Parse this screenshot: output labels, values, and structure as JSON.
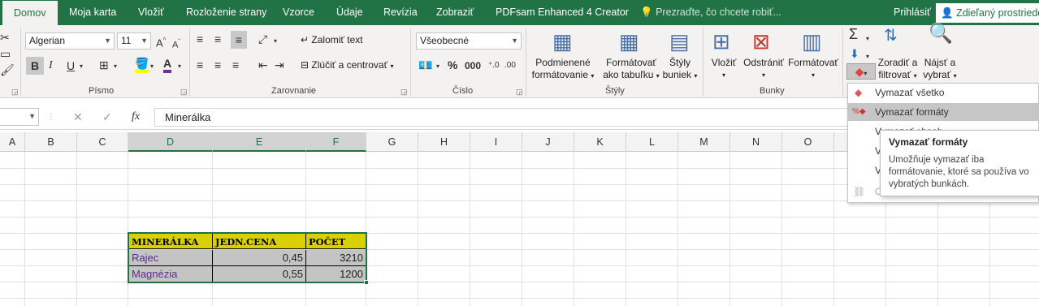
{
  "tabs": [
    "Domov",
    "Moja karta",
    "Vložiť",
    "Rozloženie strany",
    "Vzorce",
    "Údaje",
    "Revízia",
    "Zobraziť",
    "PDFsam Enhanced 4 Creator"
  ],
  "tell_me": "Prezraďte, čo chcete robiť...",
  "signin": "Prihlásiť",
  "share": "Zdieľaný prostriedok",
  "font": {
    "name": "Algerian",
    "size": "11",
    "group_label": "Písmo"
  },
  "alignment": {
    "wrap": "Zalomiť text",
    "merge": "Zlúčiť a centrovať",
    "group_label": "Zarovnanie"
  },
  "number": {
    "format": "Všeobecné",
    "group_label": "Číslo"
  },
  "styles": {
    "cond_line1": "Podmienené",
    "cond_line2": "formátovanie",
    "table_line1": "Formátovať",
    "table_line2": "ako tabuľku",
    "cell_line1": "Štýly",
    "cell_line2": "buniek",
    "group_label": "Štýly"
  },
  "cells": {
    "insert": "Vložiť",
    "delete": "Odstrániť",
    "format": "Formátovať",
    "group_label": "Bunky"
  },
  "editing": {
    "sort_line1": "Zoradiť a",
    "sort_line2": "filtrovať",
    "find_line1": "Nájsť a",
    "find_line2": "vybrať"
  },
  "formula": {
    "fx": "fx",
    "value": "Minerálka"
  },
  "columns": [
    "A",
    "B",
    "C",
    "D",
    "E",
    "F",
    "G",
    "H",
    "I",
    "J",
    "K",
    "L",
    "M",
    "N",
    "O"
  ],
  "table": {
    "headers": [
      "MINERÁLKA",
      "JEDN.CENA",
      "POČET"
    ],
    "rows": [
      [
        "Rajec",
        "0,45",
        "3210"
      ],
      [
        "Magnézia",
        "0,55",
        "1200"
      ]
    ]
  },
  "clear_menu": {
    "items": [
      "Vymazať všetko",
      "Vymazať formáty",
      "Vymazať obsah",
      "Vymazať komentáre",
      "Vymazať hypertextové prepojenia",
      "Odstrániť hypertextové prepojenia"
    ],
    "partial": [
      "Vymazať obsah",
      "V",
      "V",
      "V",
      "O"
    ]
  },
  "tooltip": {
    "title": "Vymazať formáty",
    "body": "Umožňuje vymazať iba formátovanie, ktoré sa používa vo vybratých bunkách."
  }
}
